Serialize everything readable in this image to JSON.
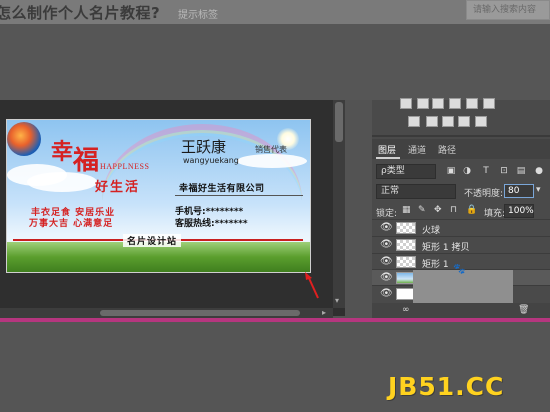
{
  "header": {
    "title": "怎么制作个人名片教程?",
    "sub_link": "提示标签",
    "search_placeholder": "请输入搜索内容"
  },
  "card": {
    "brand_char1": "幸",
    "brand_char2": "福",
    "brand_en": "HAPPLNESS",
    "brand_sub": "好生活",
    "slogan_line1": "丰衣足食 安居乐业",
    "slogan_line2": "万事大吉 心满意足",
    "person_name": "王跃康",
    "person_title": "销售代表",
    "person_pinyin": "wangyuekang",
    "company": "幸福好生活有限公司",
    "phone_label": "手机号:********",
    "hotline_label": "客服热线:*******",
    "footer_label": "名片设计站"
  },
  "layers_panel": {
    "tabs": [
      {
        "label": "图层",
        "active": true
      },
      {
        "label": "通道",
        "active": false
      },
      {
        "label": "路径",
        "active": false
      }
    ],
    "filter_type": "ρ类型",
    "blend_mode": "正常",
    "opacity_label": "不透明度:",
    "opacity_value": "80",
    "lock_label": "锁定:",
    "fill_label": "填充:",
    "fill_value": "100%",
    "layers": [
      {
        "name": "火球",
        "thumb": "transparent",
        "selected": false
      },
      {
        "name": "矩形 1 拷贝",
        "thumb": "transparent",
        "selected": false
      },
      {
        "name": "矩形 1",
        "thumb": "transparent",
        "selected": false
      },
      {
        "name": "图层",
        "thumb": "image",
        "selected": true
      },
      {
        "name": "",
        "thumb": "white",
        "selected": false
      }
    ]
  },
  "watermark": "JB51.CC",
  "colors": {
    "accent_red": "#d52222",
    "watermark_yellow": "#ffd21f",
    "pink_bar": "#b6367f"
  }
}
